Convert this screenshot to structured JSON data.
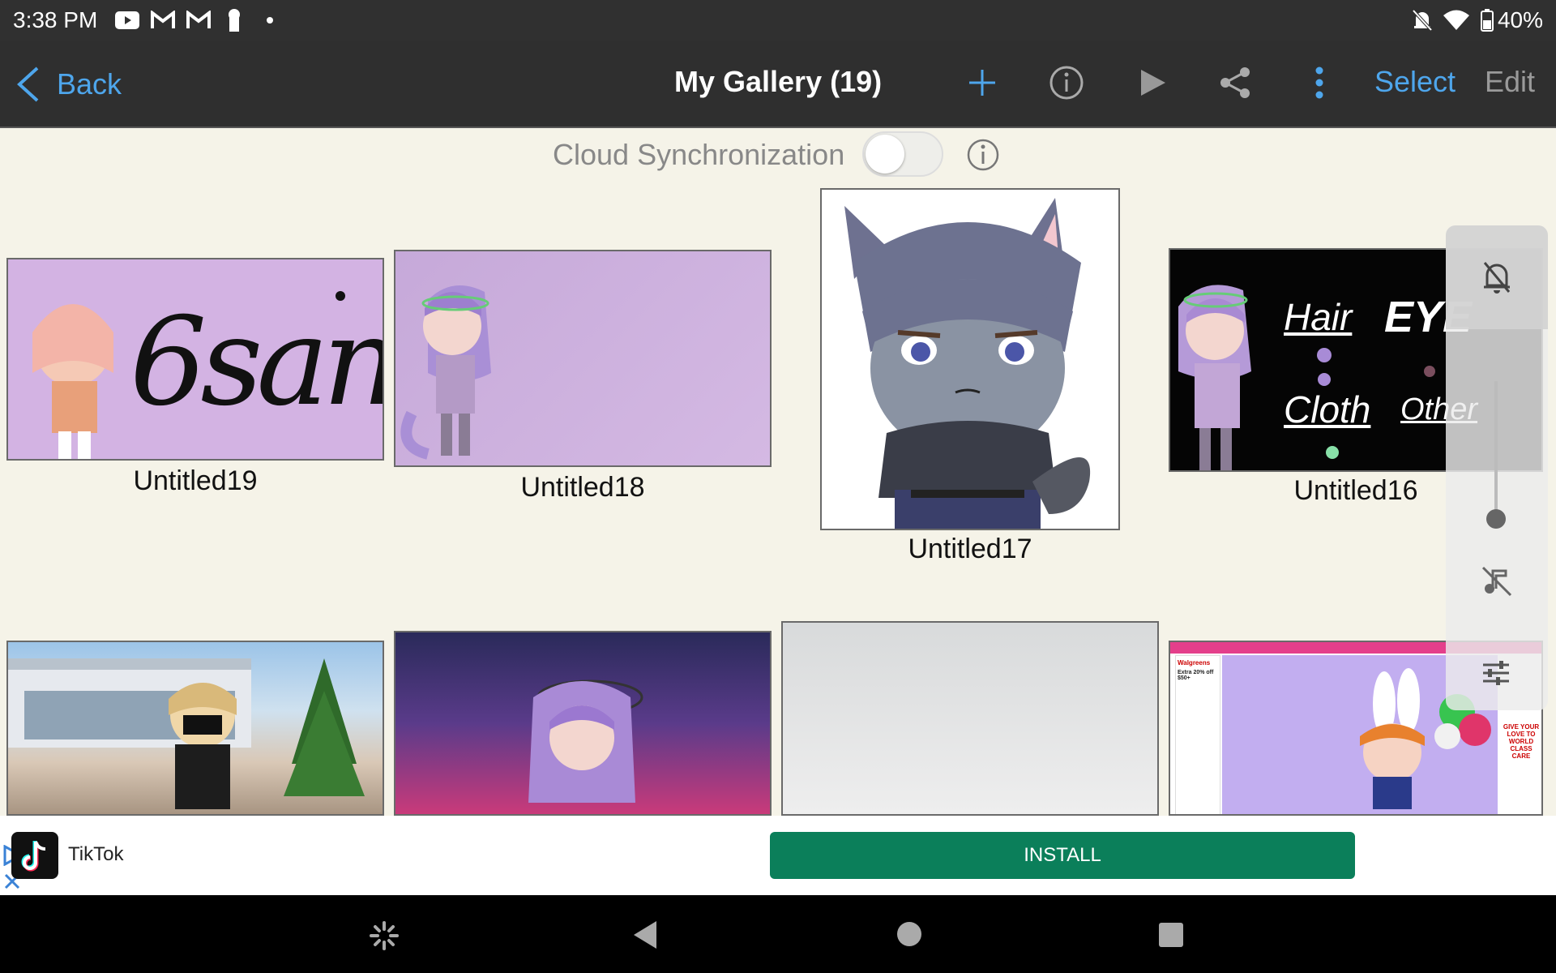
{
  "status_bar": {
    "time": "3:38 PM",
    "battery": "40%",
    "notification_icons": [
      "youtube-icon",
      "gmail-icon",
      "gmail-icon",
      "keyhole-icon",
      "dot-icon"
    ],
    "system_icons": [
      "bell-off-icon",
      "wifi-icon",
      "battery-icon"
    ]
  },
  "top_bar": {
    "back_label": "Back",
    "title": "My Gallery (19)",
    "select_label": "Select",
    "edit_label": "Edit",
    "icons": [
      "add-icon",
      "info-icon",
      "play-icon",
      "share-icon",
      "more-vertical-icon"
    ],
    "accent_color": "#4ea6ec"
  },
  "cloud_sync": {
    "label": "Cloud Synchronization",
    "enabled": false
  },
  "gallery": {
    "items": [
      {
        "title": "Untitled19",
        "thumb_text": "6san"
      },
      {
        "title": "Untitled18"
      },
      {
        "title": "Untitled17"
      },
      {
        "title": "Untitled16",
        "thumb_text": [
          "Hair",
          "EYE",
          "Cloth",
          "Other"
        ]
      },
      {
        "title": ""
      },
      {
        "title": ""
      },
      {
        "title": ""
      },
      {
        "title": "",
        "thumb_text": [
          "Walgreens",
          "Extra 20% off $50+",
          "GIVE YOUR LOVE TO WORLD CLASS CARE"
        ]
      }
    ]
  },
  "volume_panel": {
    "icons": [
      "bell-off-icon",
      "volume-slider",
      "music-off-icon",
      "equalizer-icon"
    ]
  },
  "ad": {
    "app_name": "TikTok",
    "install_label": "INSTALL",
    "button_color": "#0b7f5a"
  },
  "nav_bar": {
    "icons": [
      "accessibility-icon",
      "back-triangle-icon",
      "home-circle-icon",
      "recents-square-icon"
    ]
  }
}
